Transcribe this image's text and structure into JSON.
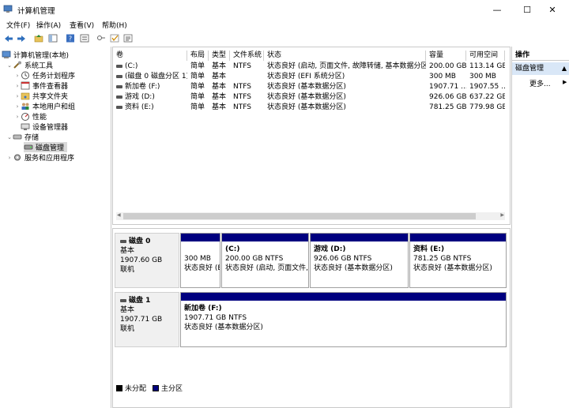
{
  "window": {
    "title": "计算机管理",
    "controls": {
      "minimize": "—",
      "maximize": "☐",
      "close": "✕"
    }
  },
  "menu": [
    "文件(F)",
    "操作(A)",
    "查看(V)",
    "帮助(H)"
  ],
  "toolbar": {
    "icons": [
      "back-arrow-icon",
      "forward-arrow-icon",
      "up-folder-icon",
      "console-tree-icon",
      "help-icon",
      "properties-icon",
      "key-icon",
      "check-icon",
      "export-list-icon"
    ]
  },
  "tree": {
    "root": "计算机管理(本地)",
    "system_tools": "系统工具",
    "task_scheduler": "任务计划程序",
    "event_viewer": "事件查看器",
    "shared_folders": "共享文件夹",
    "local_users": "本地用户和组",
    "performance": "性能",
    "device_manager": "设备管理器",
    "storage": "存储",
    "disk_management": "磁盘管理",
    "services": "服务和应用程序"
  },
  "volumes": {
    "headers": [
      "卷",
      "布局",
      "类型",
      "文件系统",
      "状态",
      "容量",
      "可用空间"
    ],
    "rows": [
      [
        "(C:)",
        "简单",
        "基本",
        "NTFS",
        "状态良好 (启动, 页面文件, 故障转储, 基本数据分区)",
        "200.00 GB",
        "113.14 GB"
      ],
      [
        "(磁盘 0 磁盘分区 1)",
        "简单",
        "基本",
        "",
        "状态良好 (EFI 系统分区)",
        "300 MB",
        "300 MB"
      ],
      [
        "新加卷 (F:)",
        "简单",
        "基本",
        "NTFS",
        "状态良好 (基本数据分区)",
        "1907.71 ...",
        "1907.55 ..."
      ],
      [
        "游戏 (D:)",
        "简单",
        "基本",
        "NTFS",
        "状态良好 (基本数据分区)",
        "926.06 GB",
        "637.22 GB"
      ],
      [
        "资料 (E:)",
        "简单",
        "基本",
        "NTFS",
        "状态良好 (基本数据分区)",
        "781.25 GB",
        "779.98 GB"
      ]
    ]
  },
  "disks": {
    "disk0": {
      "name": "磁盘 0",
      "type": "基本",
      "size": "1907.60 GB",
      "status": "联机",
      "partitions": [
        {
          "name": "",
          "size": "300 MB",
          "status": "状态良好 (EFI 系统分区)"
        },
        {
          "name": "(C:)",
          "size": "200.00 GB NTFS",
          "status": "状态良好 (启动, 页面文件, 故障转储, 基本数据分区)"
        },
        {
          "name": "游戏 (D:)",
          "size": "926.06 GB NTFS",
          "status": "状态良好 (基本数据分区)"
        },
        {
          "name": "资料 (E:)",
          "size": "781.25 GB NTFS",
          "status": "状态良好 (基本数据分区)"
        }
      ]
    },
    "disk1": {
      "name": "磁盘 1",
      "type": "基本",
      "size": "1907.71 GB",
      "status": "联机",
      "partitions": [
        {
          "name": "新加卷 (F:)",
          "size": "1907.71 GB NTFS",
          "status": "状态良好 (基本数据分区)"
        }
      ]
    }
  },
  "legend": {
    "unallocated": "未分配",
    "primary": "主分区"
  },
  "actions": {
    "header": "操作",
    "selected": "磁盘管理",
    "more": "更多..."
  },
  "colors": {
    "partition_bar": "#00007f",
    "selection": "#d9e7f7"
  }
}
